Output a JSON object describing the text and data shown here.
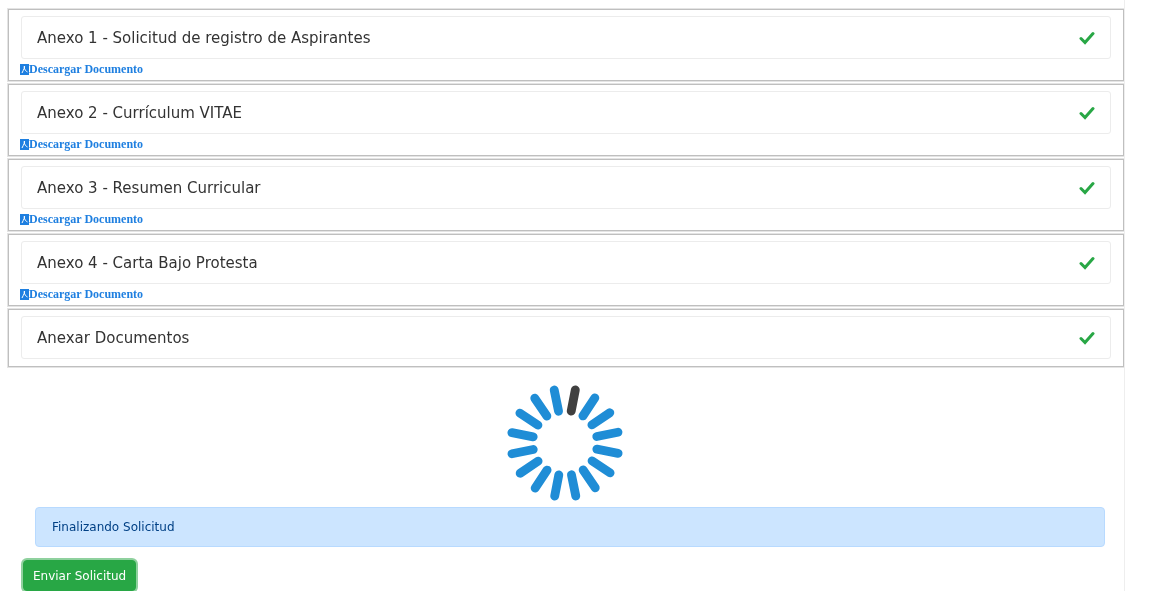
{
  "annexes": [
    {
      "title": "Anexo 1 - Solicitud de registro de Aspirantes",
      "completed": true,
      "link": "Descargar Documento"
    },
    {
      "title": "Anexo 2 - Currículum VITAE",
      "completed": true,
      "link": "Descargar Documento"
    },
    {
      "title": "Anexo 3 - Resumen Curricular",
      "completed": true,
      "link": "Descargar Documento"
    },
    {
      "title": "Anexo 4 - Carta Bajo Protesta",
      "completed": true,
      "link": "Descargar Documento"
    },
    {
      "title": "Anexar Documentos",
      "completed": true
    }
  ],
  "status_message": "Finalizando Solicitud",
  "submit_button": "Enviar Solicitud"
}
